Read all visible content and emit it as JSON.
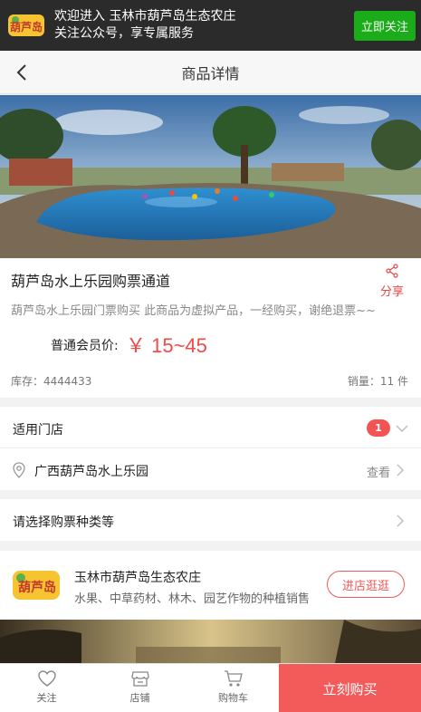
{
  "banner": {
    "logo_text": "葫芦岛",
    "line1": "欢迎进入 玉林市葫芦岛生态农庄",
    "line2": "关注公众号，享专属服务",
    "follow_button": "立即关注"
  },
  "navbar": {
    "title": "商品详情",
    "back_icon": "chevron-left-icon"
  },
  "carousel": {
    "total_slides": 4,
    "active_index": 0
  },
  "product": {
    "name": "葫芦岛水上乐园购票通道",
    "share_label": "分享",
    "description": "葫芦岛水上乐园门票购买 此商品为虚拟产品，一经购买，谢绝退票~~",
    "price_label": "普通会员价:",
    "price": "￥ 15~45",
    "stock": "库存：4444433",
    "sales": "销量：11 件"
  },
  "stores": {
    "label": "适用门店",
    "count": "1",
    "address": "广西葫芦岛水上乐园",
    "view_label": "查看"
  },
  "ticket_select": {
    "label": "请选择购票种类等"
  },
  "shop": {
    "logo_text": "葫芦岛",
    "name": "玉林市葫芦岛生态农庄",
    "description": "水果、中草药材、林木、园艺作物的种植销售",
    "visit_button": "进店逛逛"
  },
  "tabbar": {
    "items": [
      {
        "label": "关注",
        "icon": "heart-icon"
      },
      {
        "label": "店铺",
        "icon": "store-icon"
      },
      {
        "label": "购物车",
        "icon": "cart-icon"
      }
    ],
    "buy_button": "立刻购买"
  },
  "colors": {
    "accent": "#f35a5a",
    "follow_green": "#1aad19",
    "banner_bg": "#2b2b2b"
  }
}
